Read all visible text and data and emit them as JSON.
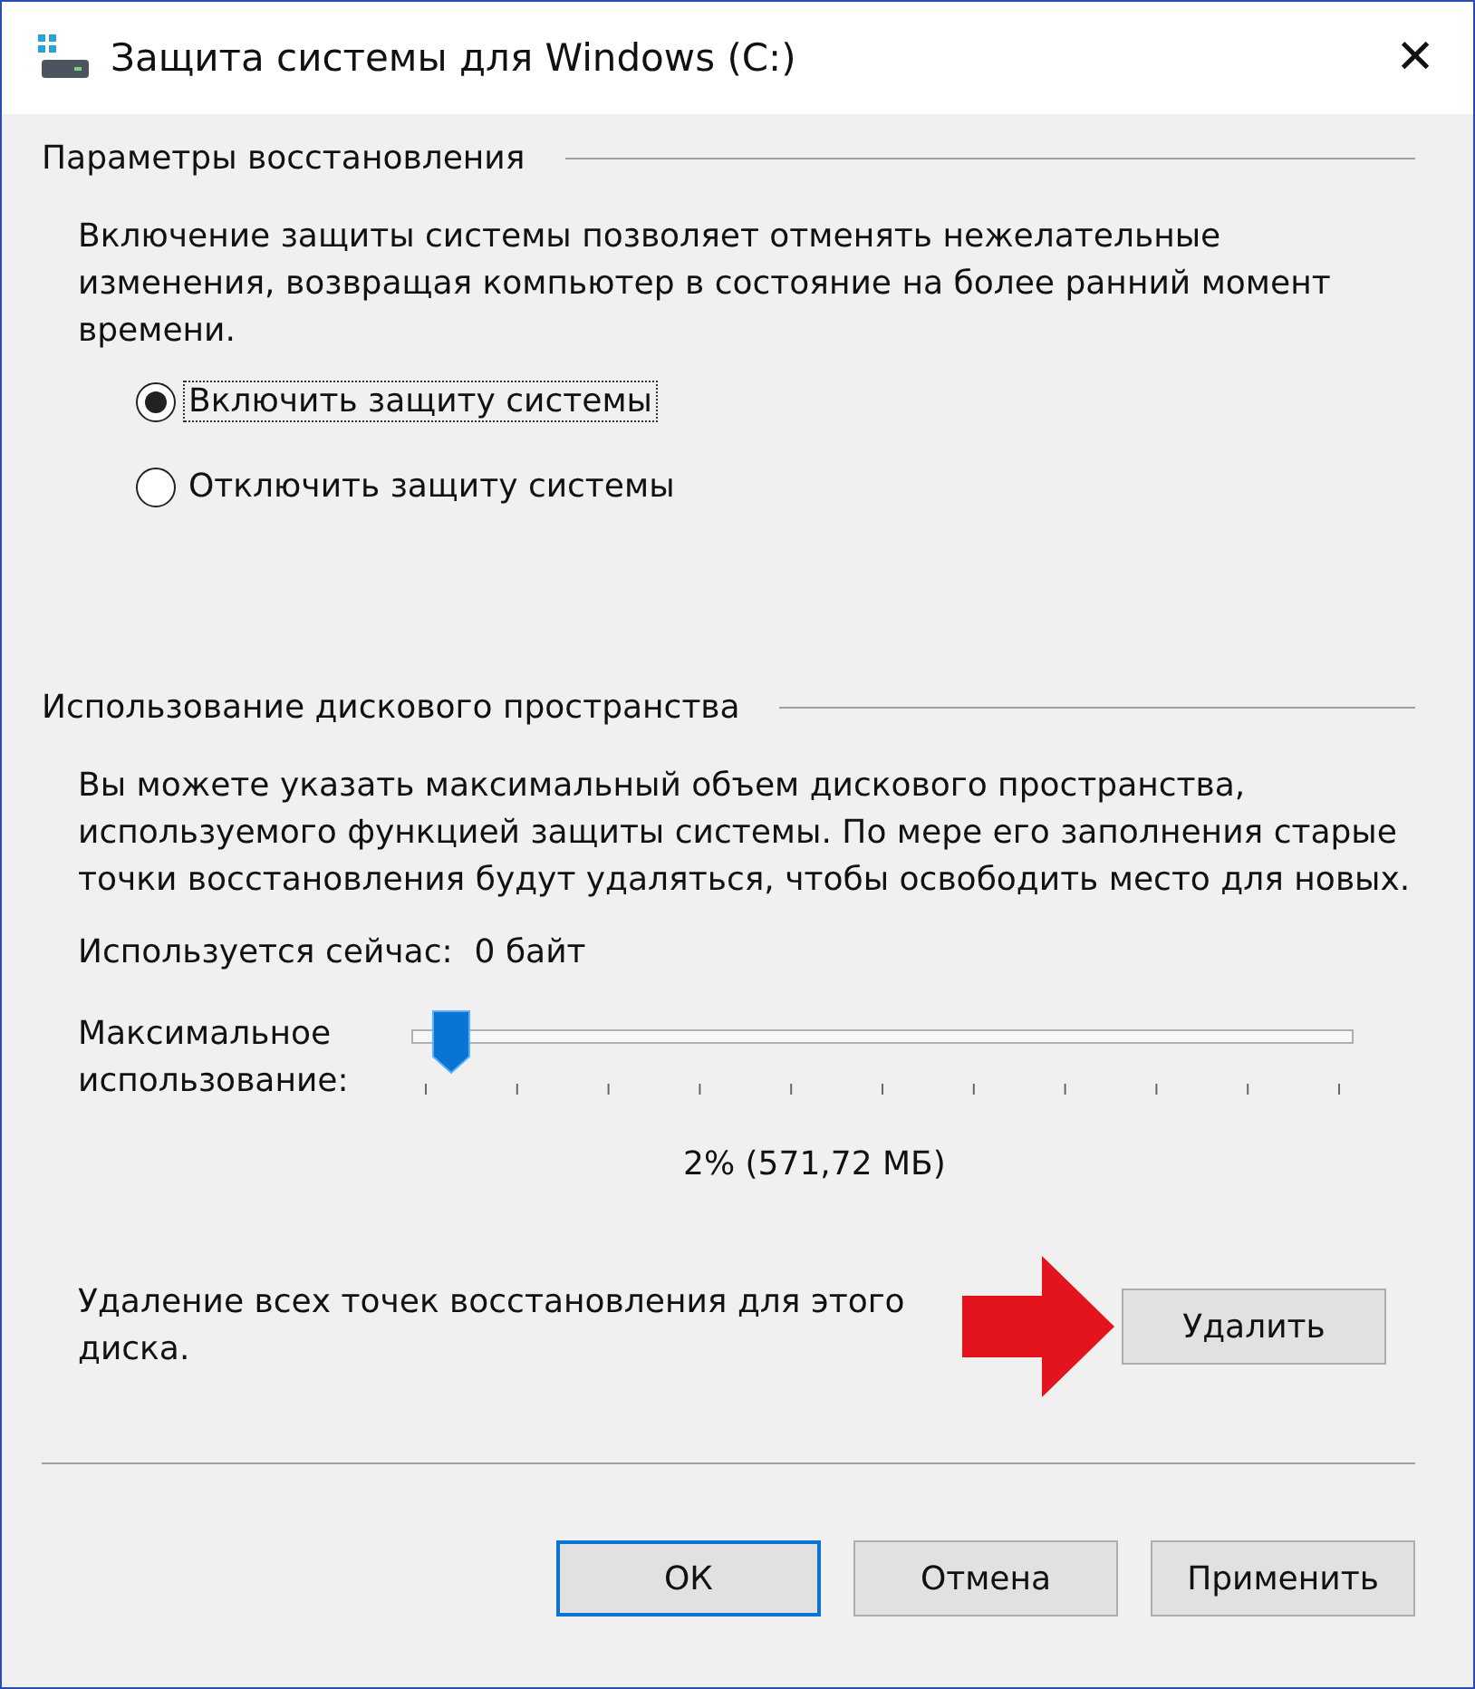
{
  "window": {
    "title": "Защита системы для Windows (C:)",
    "close": "✕"
  },
  "restore": {
    "heading": "Параметры восстановления",
    "description": "Включение защиты системы позволяет отменять нежелательные изменения, возвращая компьютер в состояние на более ранний момент времени.",
    "options": [
      {
        "label": "Включить защиту системы",
        "selected": true
      },
      {
        "label": "Отключить защиту системы",
        "selected": false
      }
    ]
  },
  "disk": {
    "heading": "Использование дискового пространства",
    "description": "Вы можете указать максимальный объем дискового пространства, используемого функцией защиты системы. По мере его заполнения старые точки восстановления будут удаляться, чтобы освободить место для новых.",
    "used_label": "Используется сейчас:",
    "used_value": "0 байт",
    "max_label": "Максимальное использование:",
    "level": 0.02,
    "reading": "2% (571,72 МБ)",
    "delete_text": "Удаление всех точек восстановления для этого диска.",
    "delete_button": "Удалить"
  },
  "buttons": [
    {
      "label": "ОК",
      "default": true
    },
    {
      "label": "Отмена",
      "default": false
    },
    {
      "label": "Применить",
      "default": false
    }
  ]
}
